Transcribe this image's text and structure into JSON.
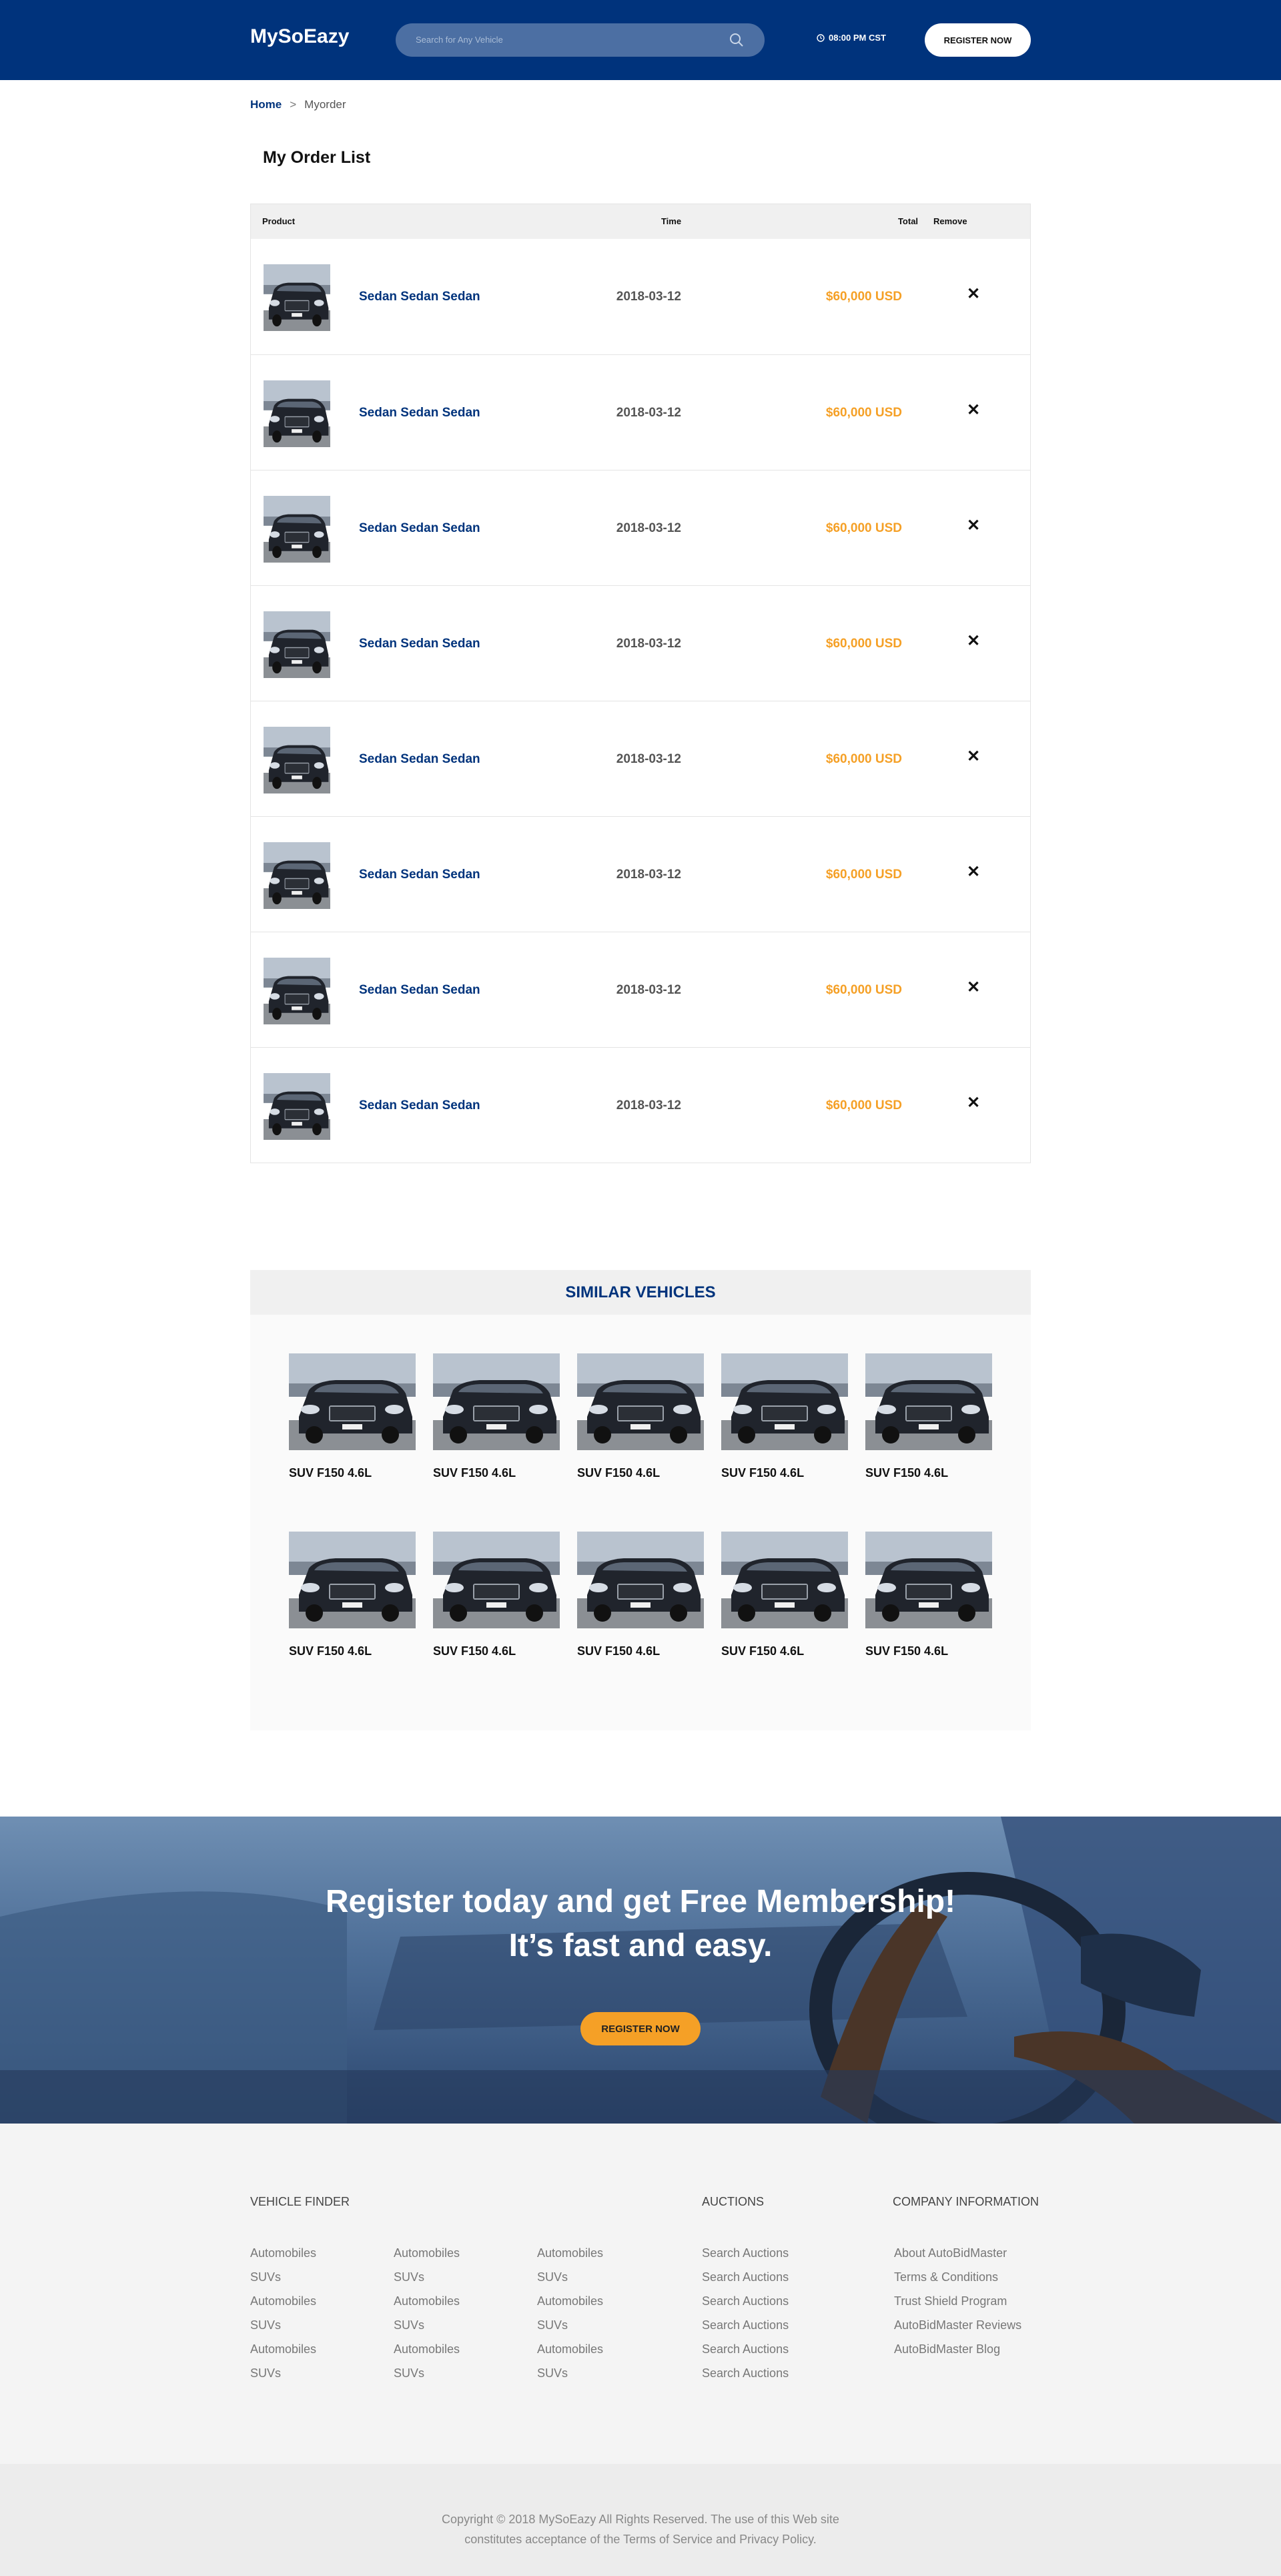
{
  "header": {
    "logo": "MySoEazy",
    "search_placeholder": "Search for Any Vehicle",
    "time": "08:00 PM CST",
    "register_label": "REGISTER NOW"
  },
  "breadcrumb": {
    "home": "Home",
    "separator": ">",
    "current": "Myorder"
  },
  "page_title": "My Order List",
  "orders": {
    "headers": {
      "product": "Product",
      "time": "Time",
      "total": "Total",
      "remove": "Remove"
    },
    "rows": [
      {
        "name": "Sedan Sedan Sedan",
        "time": "2018-03-12",
        "total": "$60,000 USD",
        "remove": "✕"
      },
      {
        "name": "Sedan Sedan Sedan",
        "time": "2018-03-12",
        "total": "$60,000 USD",
        "remove": "✕"
      },
      {
        "name": "Sedan Sedan Sedan",
        "time": "2018-03-12",
        "total": "$60,000 USD",
        "remove": "✕"
      },
      {
        "name": "Sedan Sedan Sedan",
        "time": "2018-03-12",
        "total": "$60,000 USD",
        "remove": "✕"
      },
      {
        "name": "Sedan Sedan Sedan",
        "time": "2018-03-12",
        "total": "$60,000 USD",
        "remove": "✕"
      },
      {
        "name": "Sedan Sedan Sedan",
        "time": "2018-03-12",
        "total": "$60,000 USD",
        "remove": "✕"
      },
      {
        "name": "Sedan Sedan Sedan",
        "time": "2018-03-12",
        "total": "$60,000 USD",
        "remove": "✕"
      },
      {
        "name": "Sedan Sedan Sedan",
        "time": "2018-03-12",
        "total": "$60,000 USD",
        "remove": "✕"
      }
    ]
  },
  "similar": {
    "title": "SIMILAR VEHICLES",
    "vehicles": [
      {
        "name": "SUV F150 4.6L"
      },
      {
        "name": "SUV F150 4.6L"
      },
      {
        "name": "SUV F150 4.6L"
      },
      {
        "name": "SUV F150 4.6L"
      },
      {
        "name": "SUV F150 4.6L"
      },
      {
        "name": "SUV F150 4.6L"
      },
      {
        "name": "SUV F150 4.6L"
      },
      {
        "name": "SUV F150 4.6L"
      },
      {
        "name": "SUV F150 4.6L"
      },
      {
        "name": "SUV F150 4.6L"
      }
    ]
  },
  "banner": {
    "line1": "Register today and get Free Membership!",
    "line2": "It’s fast and easy.",
    "button": "REGISTER NOW"
  },
  "footer": {
    "vehicle_finder": {
      "title": "VEHICLE FINDER",
      "col1": [
        "Automobiles",
        "SUVs",
        "Automobiles",
        "SUVs",
        "Automobiles",
        "SUVs"
      ],
      "col2": [
        "Automobiles",
        "SUVs",
        "Automobiles",
        "SUVs",
        "Automobiles",
        "SUVs"
      ],
      "col3": [
        "Automobiles",
        "SUVs",
        "Automobiles",
        "SUVs",
        "Automobiles",
        "SUVs"
      ]
    },
    "auctions": {
      "title": "AUCTIONS",
      "links": [
        "Search Auctions",
        "Search Auctions",
        "Search Auctions",
        "Search Auctions",
        "Search Auctions",
        "Search Auctions"
      ]
    },
    "company": {
      "title": "COMPANY INFORMATION",
      "links": [
        "About AutoBidMaster",
        "Terms & Conditions",
        "Trust Shield Program",
        "AutoBidMaster Reviews",
        "AutoBidMaster Blog"
      ]
    },
    "copyright_line1": "Copyright © 2018  MySoEazy All Rights Reserved. The use of this Web site",
    "copyright_line2": "constitutes acceptance of the Terms of Service and Privacy Policy."
  },
  "colors": {
    "brand_blue": "#00337c",
    "accent_orange": "#f5a026"
  }
}
